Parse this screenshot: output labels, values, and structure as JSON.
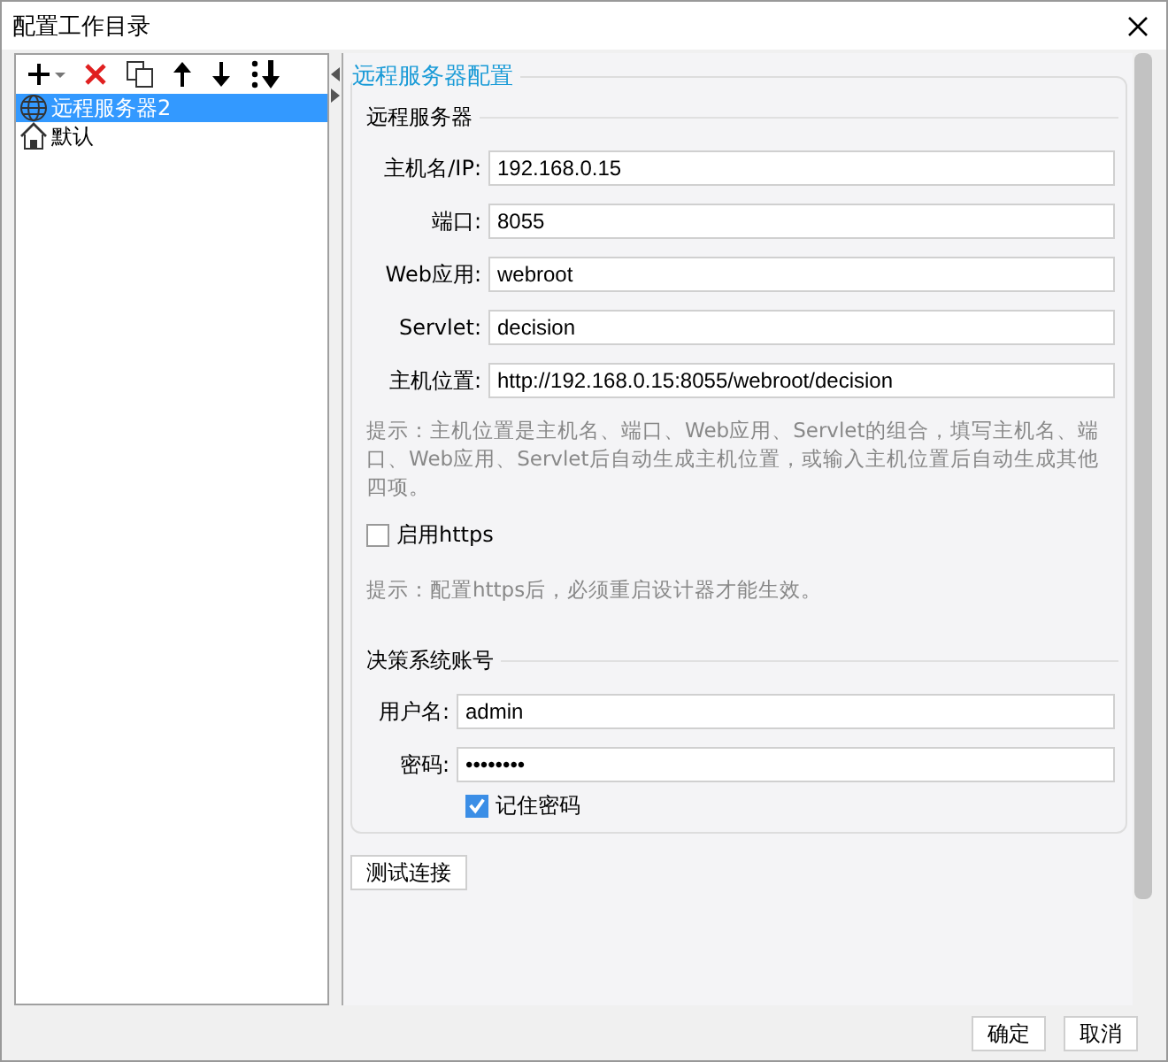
{
  "window": {
    "title": "配置工作目录"
  },
  "tree": [
    {
      "label": "远程服务器2",
      "kind": "server",
      "selected": true
    },
    {
      "label": "默认",
      "kind": "home",
      "selected": false
    }
  ],
  "panel": {
    "title": "远程服务器配置",
    "server": {
      "title": "远程服务器",
      "fields": [
        {
          "label": "主机名/IP:",
          "value": "192.168.0.15"
        },
        {
          "label": "端口:",
          "value": "8055"
        },
        {
          "label": "Web应用:",
          "value": "webroot"
        },
        {
          "label": "Servlet:",
          "value": "decision"
        },
        {
          "label": "主机位置:",
          "value": "http://192.168.0.15:8055/webroot/decision"
        }
      ],
      "hint": "提示：主机位置是主机名、端口、Web应用、Servlet的组合，填写主机名、端口、Web应用、Servlet后自动生成主机位置，或输入主机位置后自动生成其他四项。",
      "https": {
        "label": "启用https",
        "checked": false
      },
      "https_hint": "提示：配置https后，必须重启设计器才能生效。"
    },
    "account": {
      "title": "决策系统账号",
      "fields": [
        {
          "label": "用户名:",
          "value": "admin"
        },
        {
          "label": "密码:",
          "value": "••••••••"
        }
      ],
      "remember": {
        "label": "记住密码",
        "checked": true
      }
    }
  },
  "test_button": "测试连接",
  "buttons": [
    "确定",
    "取消"
  ]
}
